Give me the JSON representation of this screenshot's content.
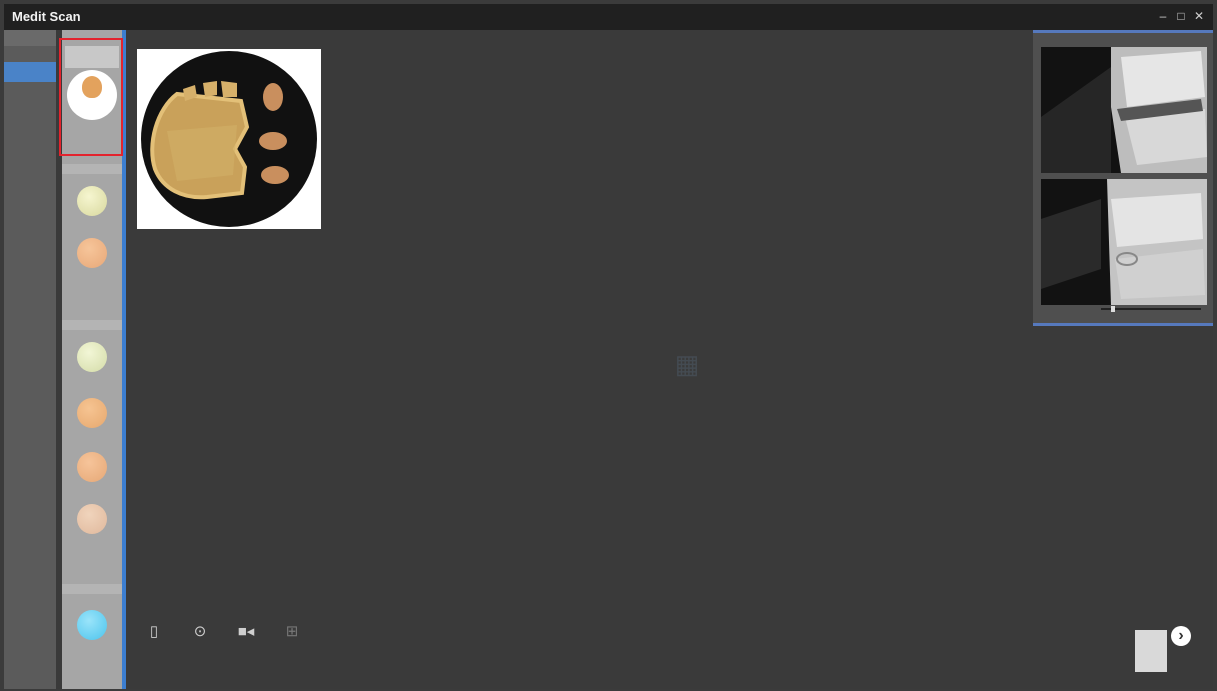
{
  "window": {
    "title": "Medit Scan",
    "subtitle": "",
    "controls": [
      "minimize",
      "maximize",
      "close"
    ]
  },
  "left_nav": {
    "header": "",
    "items": [
      {
        "label": "",
        "active": true
      },
      {
        "label": "",
        "active": false
      },
      {
        "label": "",
        "active": false
      }
    ]
  },
  "shade_panel": {
    "selected": {
      "label": ""
    },
    "groups": [
      {
        "header": "",
        "shades": [
          {
            "color": "#d8d89e",
            "label": ""
          },
          {
            "color": "#e8a878",
            "label": ""
          }
        ]
      },
      {
        "header": "",
        "shades": [
          {
            "color": "#d4dca8",
            "label": ""
          },
          {
            "color": "#e6a86e",
            "label": ""
          },
          {
            "color": "#e6a876",
            "label": ""
          },
          {
            "color": "#e0b89c",
            "label": ""
          }
        ]
      },
      {
        "header": "",
        "shades": [
          {
            "color": "#4dc4ec",
            "label": ""
          }
        ]
      }
    ]
  },
  "camera_panel": {
    "bar_label": "",
    "slider_value": 0.1
  },
  "toolbar": {
    "tools": [
      {
        "name": "tool-1",
        "label": "",
        "icon": "lock-icon"
      },
      {
        "name": "tool-2",
        "label": "",
        "icon": "reset-icon"
      },
      {
        "name": "tool-3",
        "label": "",
        "icon": "video-icon"
      },
      {
        "name": "tool-4",
        "label": "",
        "icon": "grid-icon"
      }
    ]
  },
  "next": {
    "label": ""
  },
  "colors": {
    "accent": "#4a83c8",
    "selection": "#e3232d",
    "background": "#3a3a3a"
  }
}
